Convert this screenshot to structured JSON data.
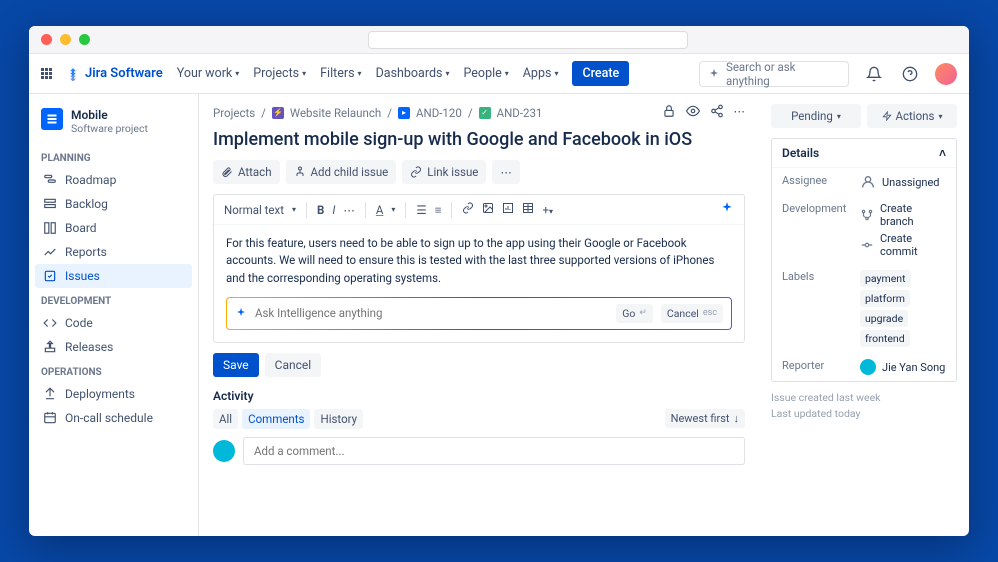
{
  "brand": "Jira Software",
  "nav": {
    "items": [
      "Your work",
      "Projects",
      "Filters",
      "Dashboards",
      "People",
      "Apps"
    ],
    "create": "Create",
    "search_placeholder": "Search or ask anything"
  },
  "sidebar": {
    "project": {
      "name": "Mobile",
      "type": "Software project"
    },
    "groups": [
      {
        "label": "PLANNING",
        "items": [
          {
            "icon": "roadmap",
            "label": "Roadmap"
          },
          {
            "icon": "backlog",
            "label": "Backlog"
          },
          {
            "icon": "board",
            "label": "Board"
          },
          {
            "icon": "reports",
            "label": "Reports"
          },
          {
            "icon": "issues",
            "label": "Issues",
            "active": true
          }
        ]
      },
      {
        "label": "DEVELOPMENT",
        "items": [
          {
            "icon": "code",
            "label": "Code"
          },
          {
            "icon": "releases",
            "label": "Releases"
          }
        ]
      },
      {
        "label": "OPERATIONS",
        "items": [
          {
            "icon": "deploy",
            "label": "Deployments"
          },
          {
            "icon": "oncall",
            "label": "On-call schedule"
          }
        ]
      }
    ]
  },
  "breadcrumb": {
    "root": "Projects",
    "project": "Website Relaunch",
    "parent": "AND-120",
    "key": "AND-231"
  },
  "issue": {
    "title": "Implement mobile sign-up with Google and Facebook in iOS",
    "actions": {
      "attach": "Attach",
      "child": "Add child issue",
      "link": "Link issue"
    },
    "toolbar_style": "Normal text",
    "description": "For this feature, users need to be able to sign up to the app using their Google or Facebook accounts. We will need to ensure this is tested with the last three supported versions of iPhones and the corresponding operating systems.",
    "ai_placeholder": "Ask Intelligence anything",
    "ai_go": "Go",
    "ai_cancel": "Cancel",
    "save": "Save",
    "cancel": "Cancel"
  },
  "activity": {
    "heading": "Activity",
    "tabs": {
      "all": "All",
      "comments": "Comments",
      "history": "History"
    },
    "sort": "Newest first",
    "comment_placeholder": "Add a comment..."
  },
  "right": {
    "status": "Pending",
    "actions": "Actions",
    "details_label": "Details",
    "fields": {
      "assignee": {
        "label": "Assignee",
        "value": "Unassigned"
      },
      "development": {
        "label": "Development",
        "branch": "Create branch",
        "commit": "Create commit"
      },
      "labels": {
        "label": "Labels",
        "values": [
          "payment",
          "platform",
          "upgrade",
          "frontend"
        ]
      },
      "reporter": {
        "label": "Reporter",
        "value": "Jie Yan Song"
      }
    },
    "meta": {
      "created": "Issue created last week",
      "updated": "Last updated today"
    }
  }
}
